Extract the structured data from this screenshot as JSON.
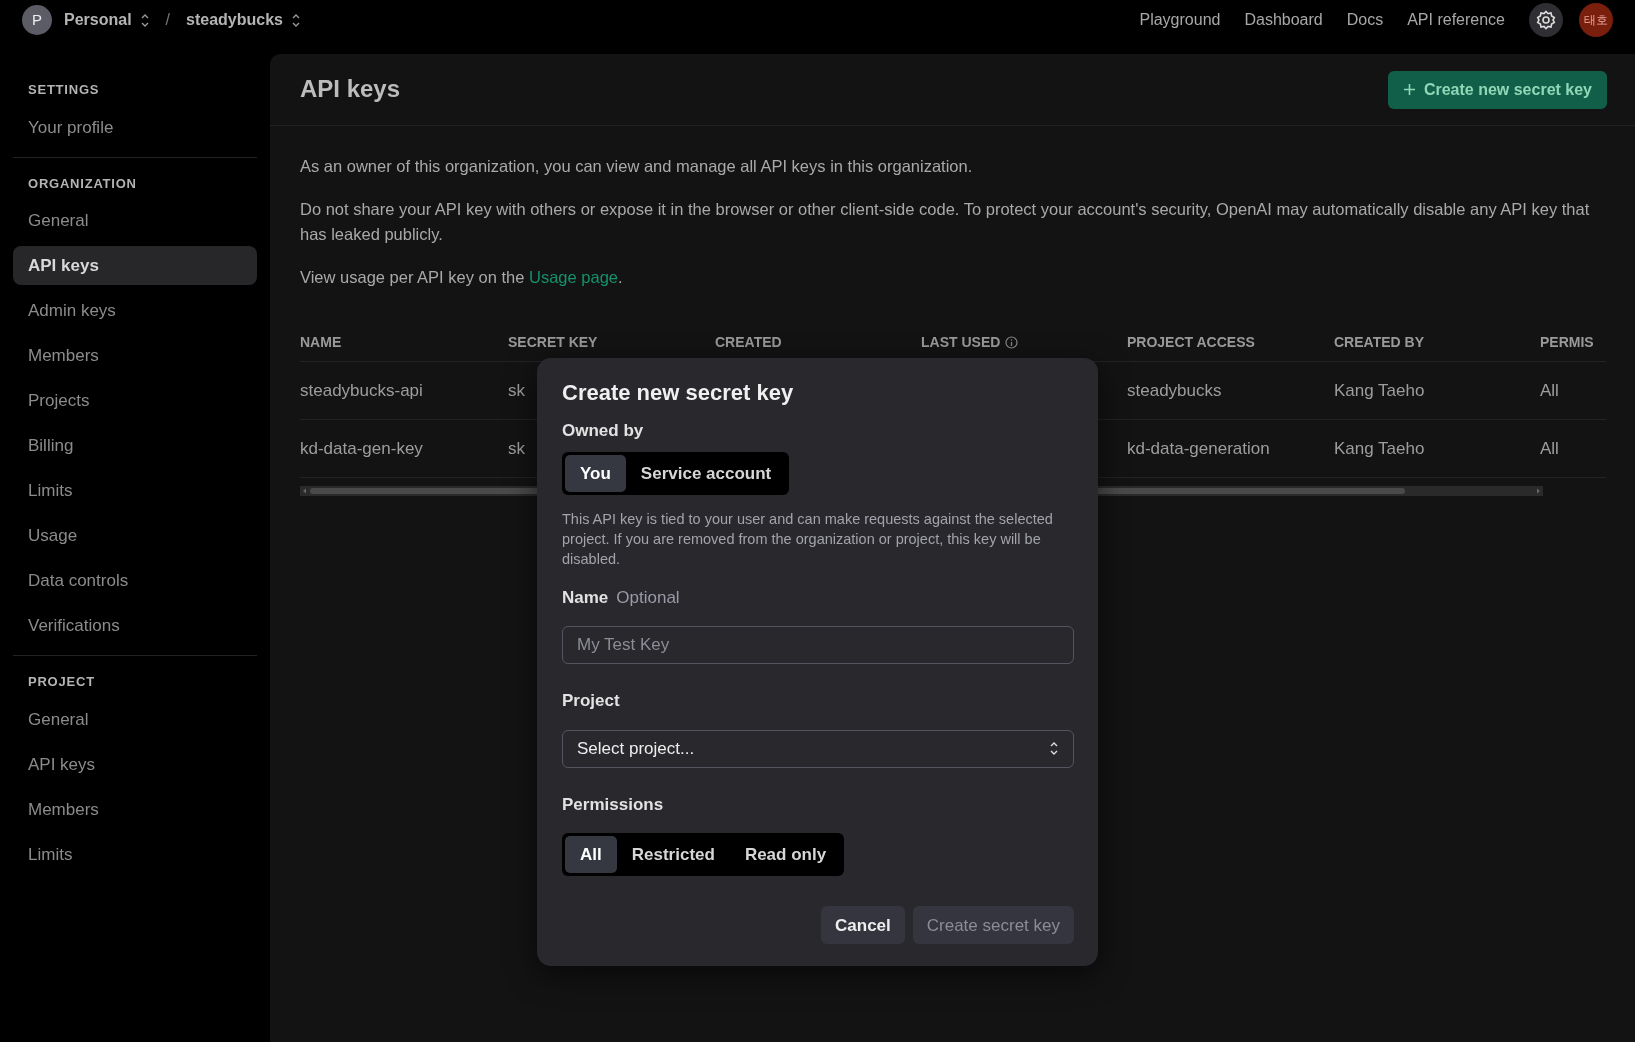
{
  "topbar": {
    "org_avatar": "P",
    "org_name": "Personal",
    "separator": "/",
    "project_name": "steadybucks",
    "links": [
      "Playground",
      "Dashboard",
      "Docs",
      "API reference"
    ],
    "user_avatar": "태호"
  },
  "sidebar": {
    "sections": [
      {
        "heading": "SETTINGS",
        "items": [
          {
            "label": "Your profile",
            "selected": false
          }
        ]
      },
      {
        "heading": "ORGANIZATION",
        "items": [
          {
            "label": "General",
            "selected": false
          },
          {
            "label": "API keys",
            "selected": true
          },
          {
            "label": "Admin keys",
            "selected": false
          },
          {
            "label": "Members",
            "selected": false
          },
          {
            "label": "Projects",
            "selected": false
          },
          {
            "label": "Billing",
            "selected": false
          },
          {
            "label": "Limits",
            "selected": false
          },
          {
            "label": "Usage",
            "selected": false
          },
          {
            "label": "Data controls",
            "selected": false
          },
          {
            "label": "Verifications",
            "selected": false
          }
        ]
      },
      {
        "heading": "PROJECT",
        "items": [
          {
            "label": "General",
            "selected": false
          },
          {
            "label": "API keys",
            "selected": false
          },
          {
            "label": "Members",
            "selected": false
          },
          {
            "label": "Limits",
            "selected": false
          }
        ]
      }
    ]
  },
  "page": {
    "title": "API keys",
    "create_button": "Create new secret key",
    "paragraphs": [
      "As an owner of this organization, you can view and manage all API keys in this organization.",
      "Do not share your API key with others or expose it in the browser or other client-side code. To protect your account's security, OpenAI may automatically disable any API key that has leaked publicly."
    ],
    "usage_note": {
      "before": "View usage per API key on the ",
      "link": "Usage page",
      "after": "."
    }
  },
  "table": {
    "columns": [
      {
        "label": "NAME",
        "info": false
      },
      {
        "label": "SECRET KEY",
        "info": false
      },
      {
        "label": "CREATED",
        "info": false
      },
      {
        "label": "LAST USED",
        "info": true
      },
      {
        "label": "PROJECT ACCESS",
        "info": false
      },
      {
        "label": "CREATED BY",
        "info": false
      },
      {
        "label": "PERMIS",
        "info": false
      }
    ],
    "rows": [
      {
        "cells": [
          "steadybucks-api",
          "sk",
          null,
          null,
          "steadybucks",
          "Kang Taeho",
          "All"
        ]
      },
      {
        "cells": [
          "kd-data-gen-key",
          "sk",
          null,
          null,
          "kd-data-generation",
          "Kang Taeho",
          "All"
        ]
      }
    ]
  },
  "dialog": {
    "title": "Create new secret key",
    "owner_label": "Owned by",
    "owner_options": [
      {
        "label": "You",
        "selected": true
      },
      {
        "label": "Service account",
        "selected": false
      }
    ],
    "description": "This API key is tied to your user and can make requests against the selected project. If you are removed from the organization or project, this key will be disabled.",
    "name_label": "Name",
    "name_hint": "Optional",
    "name_field": {
      "placeholder": "My Test Key"
    },
    "project_label": "Project",
    "project_select": {
      "value": "Select project..."
    },
    "permissions_label": "Permissions",
    "permission_options": [
      {
        "label": "All",
        "selected": true
      },
      {
        "label": "Restricted",
        "selected": false
      },
      {
        "label": "Read only",
        "selected": false
      }
    ],
    "buttons": [
      {
        "label": "Cancel",
        "disabled": false
      },
      {
        "label": "Create secret key",
        "disabled": true
      }
    ]
  }
}
